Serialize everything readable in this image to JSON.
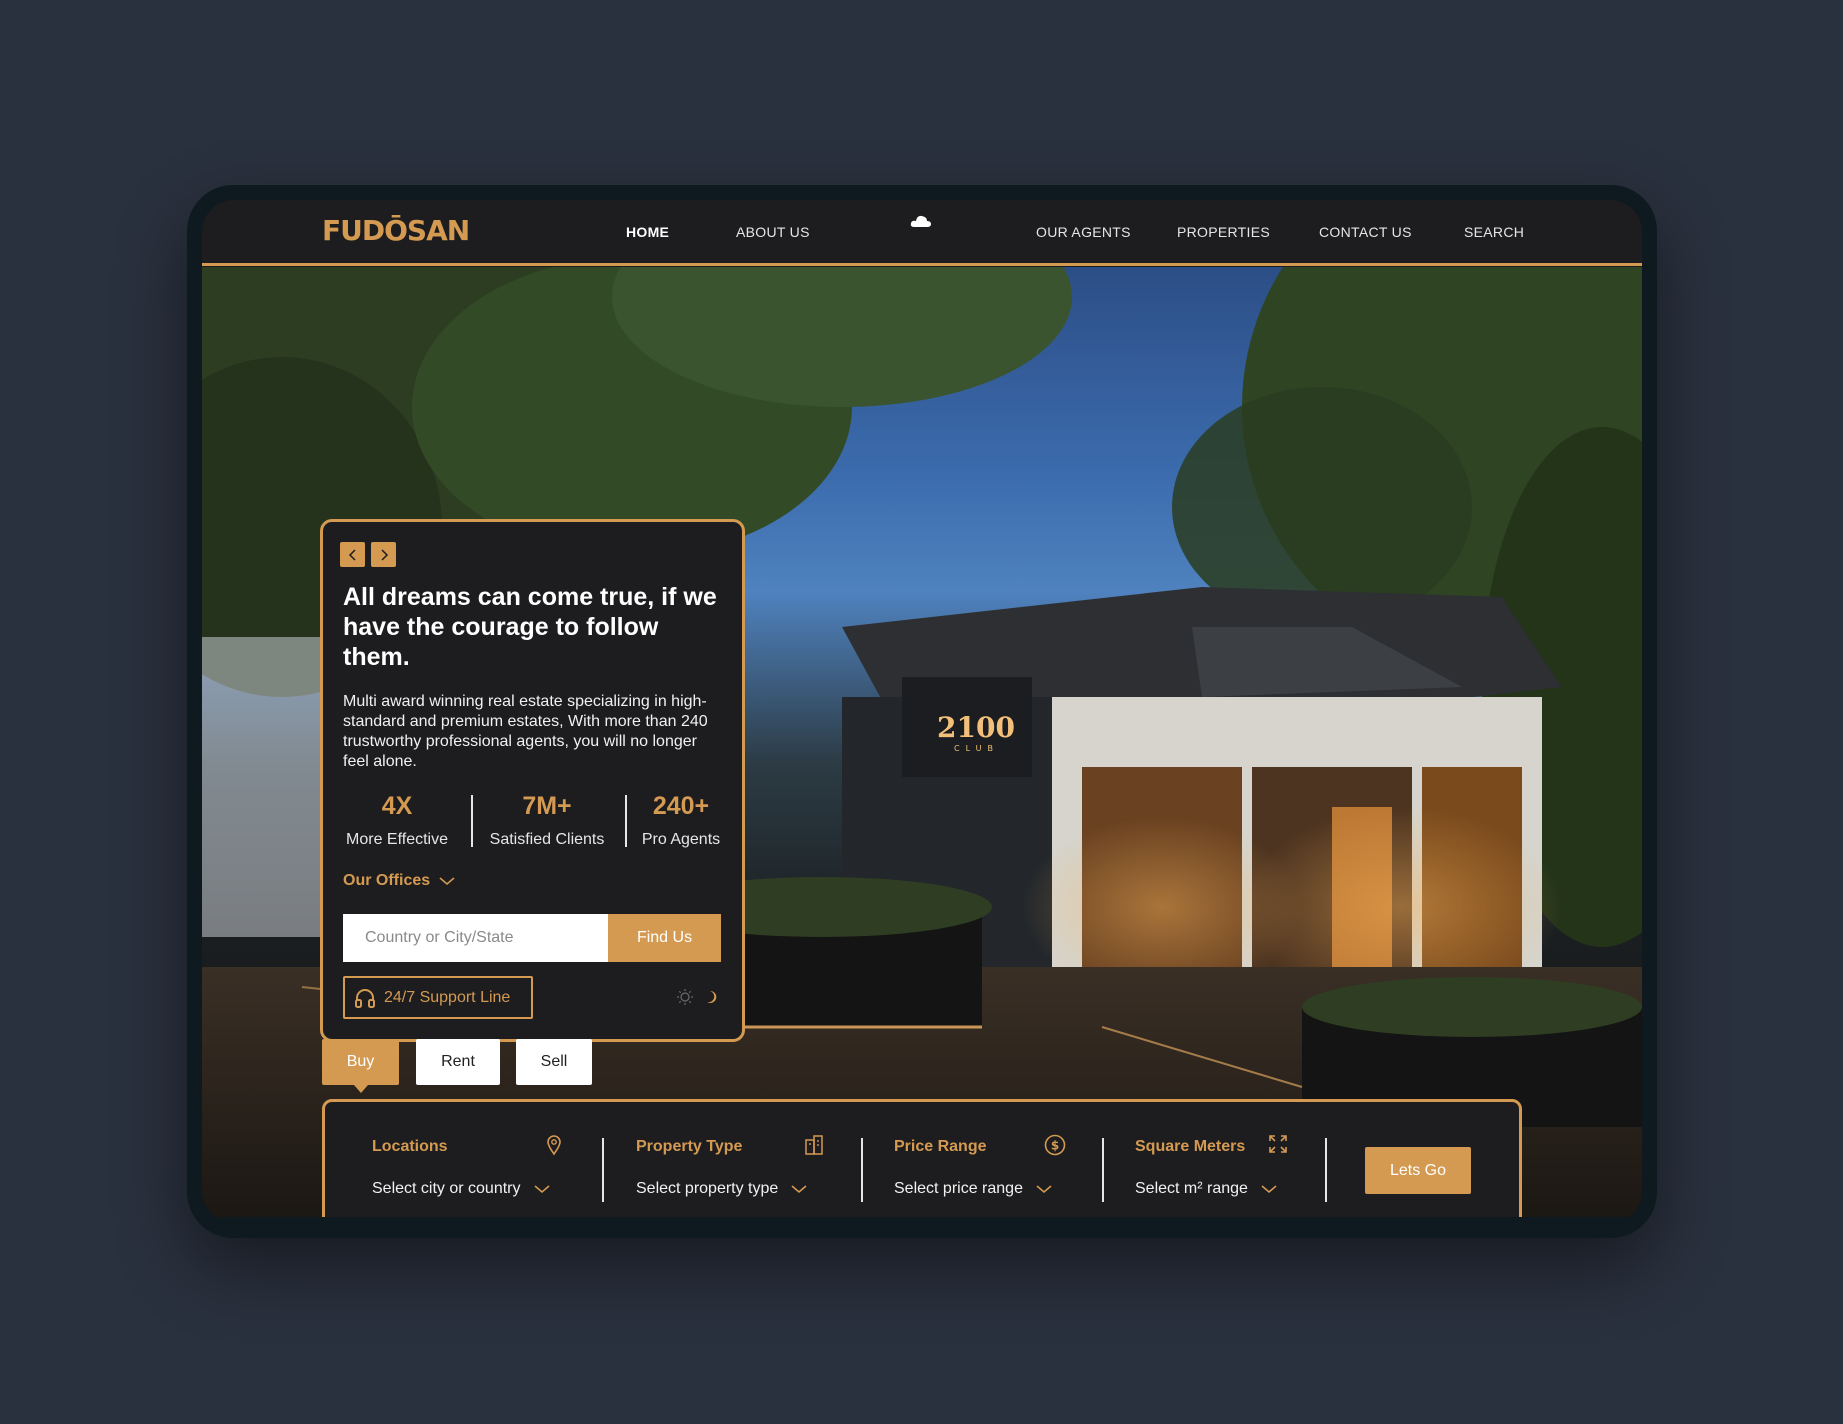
{
  "brand": {
    "logo": "FUDŌSAN",
    "accent": "#d49a52",
    "background": "#2a313e",
    "panel": "#1d1d1f"
  },
  "nav": {
    "links": [
      "HOME",
      "ABOUT US",
      "OUR AGENTS",
      "PROPERTIES",
      "CONTACT US",
      "SEARCH"
    ],
    "active": "HOME",
    "center_icon": "cloud-icon"
  },
  "hero": {
    "headline": "All dreams can come true, if we have the courage to follow them.",
    "description": "Multi award winning real estate specializing in high-standard and premium estates, With more than 240 trustworthy professional agents, you will no longer feel alone.",
    "sign_text": "2100",
    "sign_subtext": "CLUB",
    "stats": [
      {
        "value": "4X",
        "label": "More Effective"
      },
      {
        "value": "7M+",
        "label": "Satisfied Clients"
      },
      {
        "value": "240+",
        "label": "Pro Agents"
      }
    ],
    "offices_label": "Our Offices",
    "search": {
      "placeholder": "Country or City/State",
      "button": "Find Us"
    },
    "support_label": "24/7 Support Line"
  },
  "tabs": [
    "Buy",
    "Rent",
    "Sell"
  ],
  "active_tab": "Buy",
  "filters": [
    {
      "title": "Locations",
      "value": "Select city or country",
      "icon": "map-pin-icon"
    },
    {
      "title": "Property Type",
      "value": "Select property type",
      "icon": "building-icon"
    },
    {
      "title": "Price Range",
      "value": "Select price range",
      "icon": "dollar-icon"
    },
    {
      "title": "Square Meters",
      "value": "Select m² range",
      "icon": "expand-icon"
    }
  ],
  "cta": "Lets Go"
}
